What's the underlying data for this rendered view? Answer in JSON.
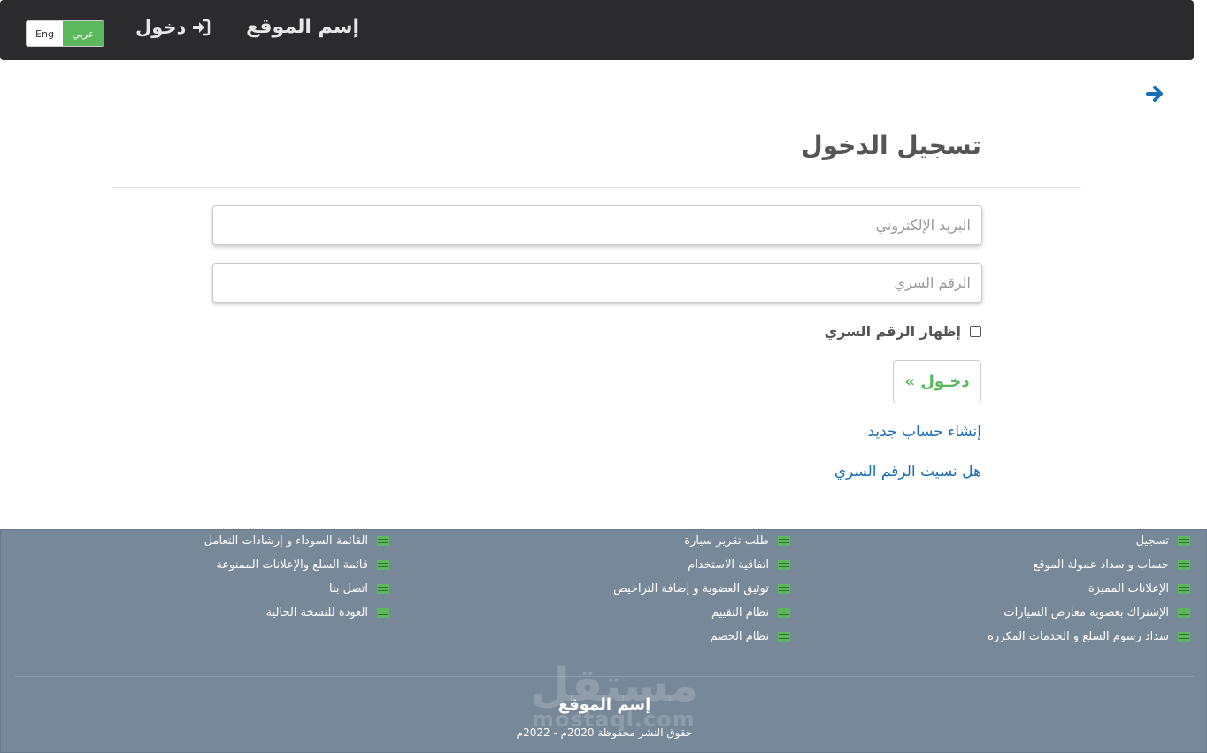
{
  "navbar": {
    "brand": "إسم الموقع",
    "login_label": "دخول",
    "login_icon": "sign-in-icon",
    "lang_eng": "Eng",
    "lang_ar": "عربي",
    "lang_active_color": "#5cb85c"
  },
  "page": {
    "back_icon": "arrow-right-icon",
    "title": "تسجيل الدخول"
  },
  "form": {
    "email_placeholder": "البريد الإلكتروني",
    "password_placeholder": "الرقم السري",
    "show_password_label": "إظهار الرقم السري",
    "submit_label": "دخـول »",
    "register_link": "إنشاء حساب جديد",
    "forgot_link": "هل نسيت الرقم السري"
  },
  "footer": {
    "col1": [
      "تسجيل",
      "حساب و سداد عمولة الموقع",
      "الإعلانات المميزة",
      "الإشتراك بعضوية معارض السيارات",
      "سداد رسوم السلع و الخدمات المكررة"
    ],
    "col2": [
      "طلب تقرير سيارة",
      "اتفاقية الاستخدام",
      "توثيق العضوية و إضافة التراخيص",
      "نظام التقييم",
      "نظام الخصم"
    ],
    "col3": [
      "القائمة السوداء و إرشادات التعامل",
      "قائمة السلع والإعلانات الممنوعة",
      "اتصل بنا",
      "العودة للنسخة الحالية"
    ],
    "watermark": "مستقل",
    "watermark_latin": "mostaql.com",
    "brand": "إسم الموقع",
    "copyright": "حقوق النشر محفوظة 2020م - 2022م",
    "background_color": "#778899"
  }
}
